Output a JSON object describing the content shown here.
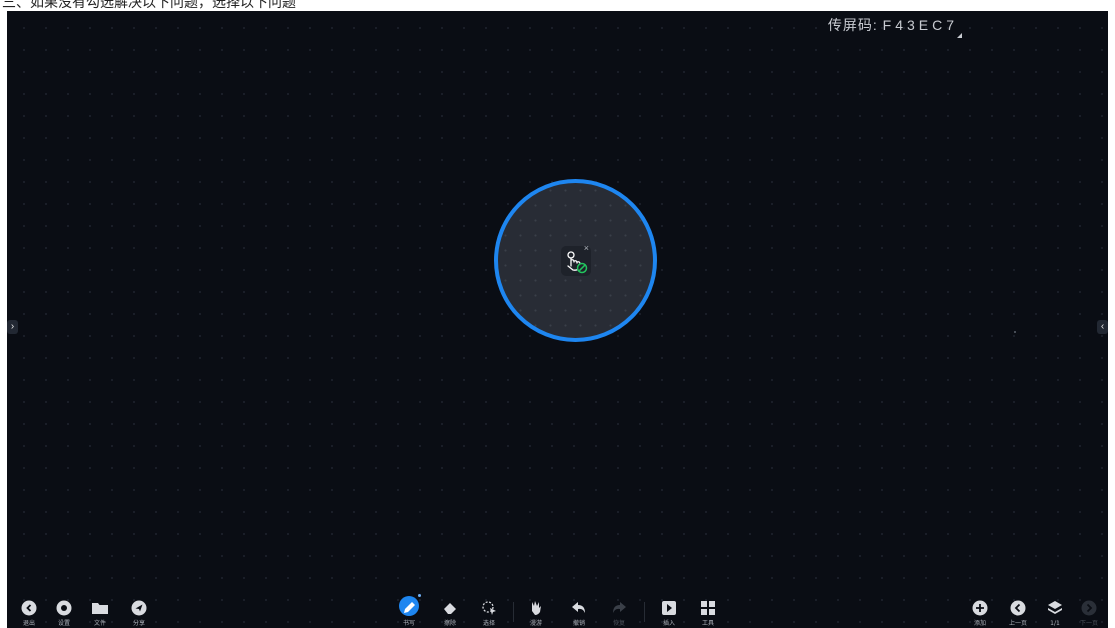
{
  "caption": "三、如果没有勾选解决以下问题，选择以下问题",
  "screen_code": {
    "label": "传屏码:",
    "value": "F43EC7"
  },
  "edge": {
    "left_arrow": "›",
    "right_arrow": "‹"
  },
  "center_tool": {
    "icon": "touch-disabled-icon",
    "close": "×"
  },
  "toolbar": {
    "left": [
      {
        "name": "exit",
        "label": "退出",
        "icon": "exit-icon"
      },
      {
        "name": "settings",
        "label": "设置",
        "icon": "gear-icon"
      },
      {
        "name": "files",
        "label": "文件",
        "icon": "folder-icon"
      },
      {
        "name": "share",
        "label": "分享",
        "icon": "share-icon"
      }
    ],
    "center": [
      {
        "name": "pen",
        "label": "书写",
        "icon": "pen-icon",
        "active": true
      },
      {
        "name": "eraser",
        "label": "擦除",
        "icon": "eraser-icon"
      },
      {
        "name": "select",
        "label": "选择",
        "icon": "lasso-select-icon"
      },
      {
        "name": "roam",
        "label": "漫游",
        "icon": "hand-icon"
      },
      {
        "name": "undo",
        "label": "撤销",
        "icon": "undo-icon"
      },
      {
        "name": "redo",
        "label": "恢复",
        "icon": "redo-icon",
        "disabled": true
      },
      {
        "name": "insert",
        "label": "插入",
        "icon": "insert-icon"
      },
      {
        "name": "tools",
        "label": "工具",
        "icon": "apps-grid-icon"
      }
    ],
    "right": [
      {
        "name": "add-page",
        "label": "添加",
        "icon": "plus-circle-icon"
      },
      {
        "name": "prev-page",
        "label": "上一页",
        "icon": "chevron-left-circle-icon"
      },
      {
        "name": "pages",
        "label": "1/1",
        "icon": "layers-icon"
      },
      {
        "name": "next-page",
        "label": "下一页",
        "icon": "chevron-right-circle-icon",
        "disabled": true
      }
    ]
  },
  "colors": {
    "board": "#0a0d14",
    "accent": "#1e86f0",
    "ring_fill": "#282c35",
    "success": "#22c55e"
  }
}
